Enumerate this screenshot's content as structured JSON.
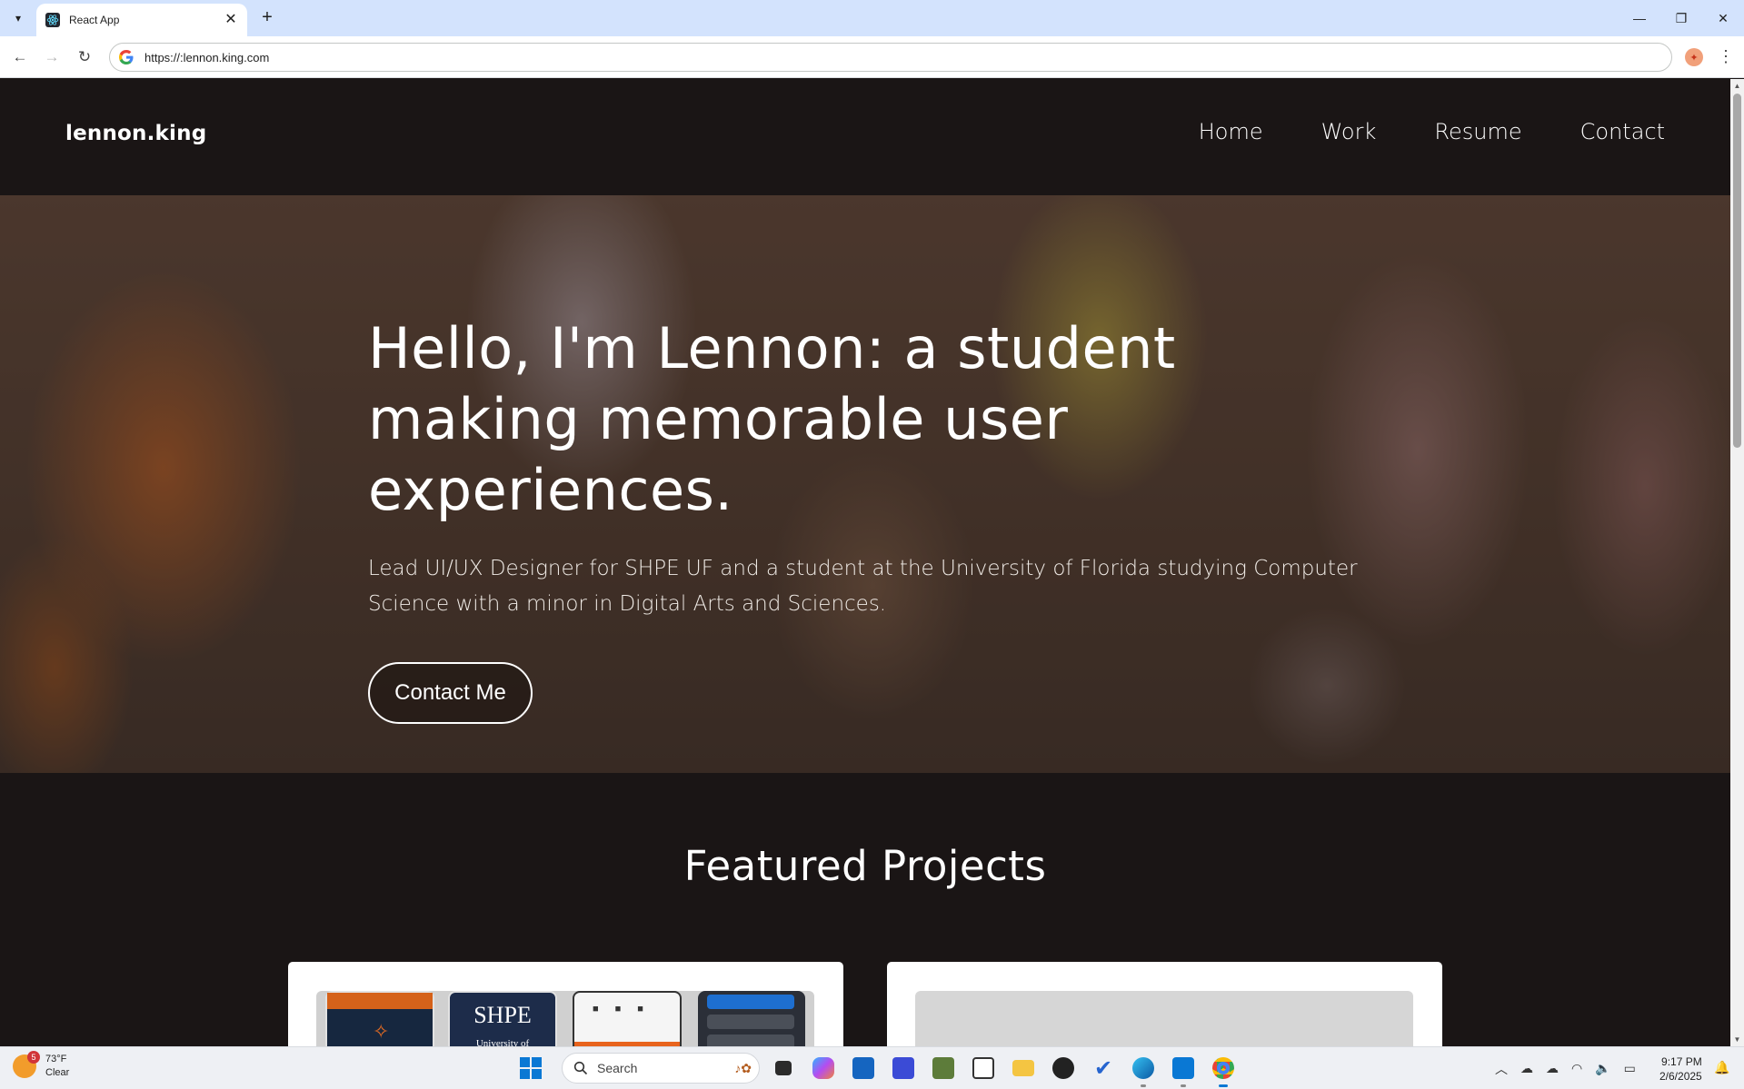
{
  "browser": {
    "tab_title": "React App",
    "url": "https://:lennon.king.com",
    "tab_close_glyph": "✕",
    "new_tab_glyph": "+"
  },
  "site": {
    "logo": "lennon.king",
    "nav": [
      "Home",
      "Work",
      "Resume",
      "Contact"
    ]
  },
  "hero": {
    "heading": "Hello, I'm Lennon: a student making memorable user experiences.",
    "subheading": "Lead UI/UX Designer for SHPE UF and a student at the University of Florida studying Computer Science with a minor in Digital Arts and Sciences.",
    "button": "Contact Me"
  },
  "projects": {
    "title": "Featured Projects",
    "card1": {
      "mock_title": "SHPE",
      "mock_sub": "University of"
    }
  },
  "taskbar": {
    "weather_temp": "73°F",
    "weather_cond": "Clear",
    "weather_badge": "5",
    "search_placeholder": "Search",
    "time": "9:17 PM",
    "date": "2/6/2025"
  },
  "colors": {
    "page_bg": "#1a1515",
    "accent": "#0a78d4",
    "shpe_orange": "#d5621a",
    "shpe_navy": "#16273f"
  }
}
